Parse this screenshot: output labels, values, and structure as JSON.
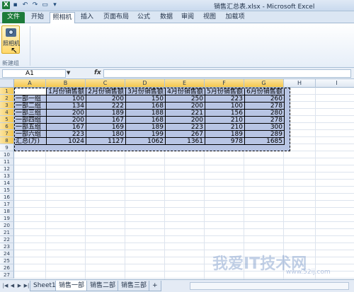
{
  "window": {
    "title": "销售汇总表.xlsx - Microsoft Excel"
  },
  "ribbon": {
    "tabs": [
      "文件",
      "开始",
      "照相机",
      "插入",
      "页面布局",
      "公式",
      "数据",
      "审阅",
      "视图",
      "加载项"
    ],
    "active_tab": "照相机",
    "camera_button_label": "照相机",
    "group_label": "新建组"
  },
  "formula_bar": {
    "name_box": "A1",
    "fx_label": "fx",
    "formula": ""
  },
  "grid": {
    "columns": [
      "A",
      "B",
      "C",
      "D",
      "E",
      "F",
      "G",
      "H",
      "I"
    ],
    "rows": [
      "1",
      "2",
      "3",
      "4",
      "5",
      "6",
      "7",
      "8",
      "9",
      "10",
      "11",
      "12",
      "13",
      "14",
      "15",
      "16",
      "17",
      "18",
      "19",
      "20",
      "21",
      "22",
      "23",
      "24",
      "25",
      "26",
      "27"
    ],
    "table": {
      "header": [
        "",
        "1月份销售额",
        "2月份销售额",
        "3月份销售额",
        "4月份销售额",
        "5月份销售额",
        "6月份销售额"
      ],
      "rows": [
        [
          "一部一组",
          "100",
          "200",
          "150",
          "250",
          "223",
          "260"
        ],
        [
          "一部二组",
          "134",
          "222",
          "168",
          "200",
          "100",
          "278"
        ],
        [
          "一部三组",
          "200",
          "189",
          "188",
          "221",
          "156",
          "280"
        ],
        [
          "一部四组",
          "200",
          "167",
          "168",
          "200",
          "210",
          "278"
        ],
        [
          "一部五组",
          "167",
          "169",
          "189",
          "223",
          "210",
          "300"
        ],
        [
          "一部六组",
          "223",
          "180",
          "199",
          "267",
          "189",
          "289"
        ],
        [
          "汇总(万)",
          "1024",
          "1127",
          "1062",
          "1361",
          "978",
          "1685"
        ]
      ]
    }
  },
  "sheet_tabs": [
    "Sheet1",
    "销售一部",
    "销售二部",
    "销售三部"
  ],
  "active_sheet": "销售一部",
  "watermark": {
    "text": "我爱IT技术网",
    "url": "www.52ij.com"
  },
  "colors": {
    "selection_fill": "#b8c5e4",
    "excel_green": "#1d7b3a",
    "header_highlight": "#f4c64c"
  }
}
